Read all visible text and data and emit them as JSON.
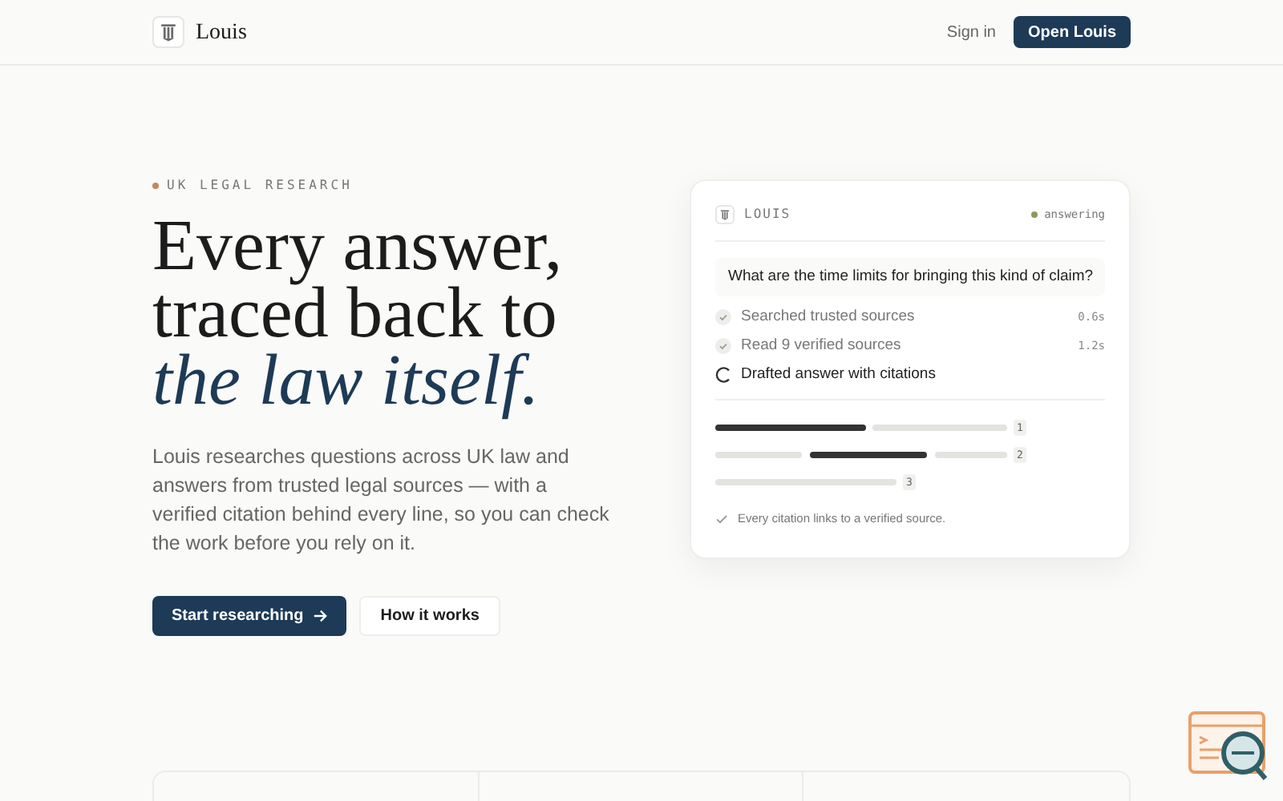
{
  "nav": {
    "brand": "Louis",
    "sign_in": "Sign in",
    "cta": "Open Louis"
  },
  "hero": {
    "eyebrow": "UK LEGAL RESEARCH",
    "title_lines": [
      "Every answer,",
      "traced back to"
    ],
    "title_accent": "the law itself.",
    "body": "Louis researches questions across UK law and answers from trusted legal sources — with a verified citation behind every line, so you can check the work before you rely on it.",
    "primary_button": "Start researching",
    "secondary_button": "How it works"
  },
  "card": {
    "name": "LOUIS",
    "status": "answering",
    "question": "What are the time limits for bringing this kind of claim?",
    "steps": [
      {
        "kind": "done",
        "label": "Searched trusted sources",
        "time": "0.6s"
      },
      {
        "kind": "done",
        "label": "Read 9 verified sources",
        "time": "1.2s"
      },
      {
        "kind": "active",
        "label": "Drafted answer with citations"
      }
    ],
    "citations": [
      "1",
      "2",
      "3"
    ],
    "footnote": "Every citation links to a verified source."
  }
}
